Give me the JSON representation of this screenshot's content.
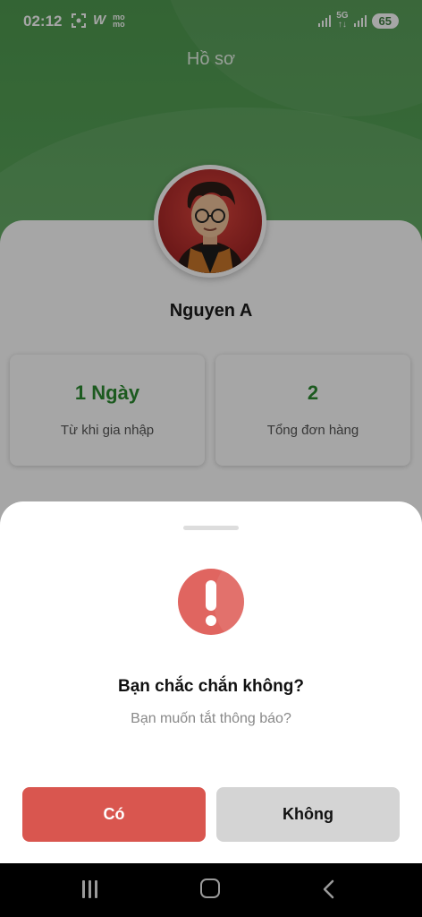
{
  "status_bar": {
    "time": "02:12",
    "left_icons": [
      "screenshot-icon",
      "w-icon",
      "momo-icon"
    ],
    "w_label": "W",
    "momo_label": "mo\nmo",
    "network_label": "5G",
    "battery": "65"
  },
  "header": {
    "title": "Hồ sơ"
  },
  "profile": {
    "name": "Nguyen A",
    "stats": [
      {
        "value": "1 Ngày",
        "label": "Từ khi gia nhập"
      },
      {
        "value": "2",
        "label": "Tổng đơn hàng"
      }
    ]
  },
  "dialog": {
    "icon": "alert-icon",
    "title": "Bạn chắc chắn không?",
    "message": "Bạn muốn tắt thông báo?",
    "confirm_label": "Có",
    "cancel_label": "Không"
  },
  "colors": {
    "header_green": "#4f9a50",
    "stat_green": "#2b8a31",
    "confirm_red": "#d9564f",
    "alert_red": "#e06560",
    "cancel_gray": "#d4d4d4"
  },
  "nav_bar": {
    "items": [
      "recent-apps-icon",
      "home-icon",
      "back-icon"
    ]
  }
}
